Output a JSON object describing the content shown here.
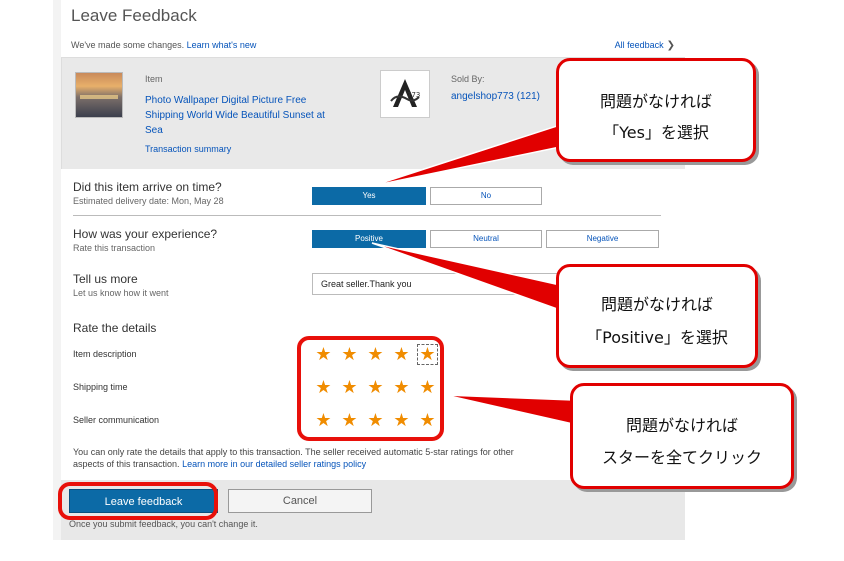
{
  "page": {
    "title": "Leave Feedback",
    "notice_text": "We've made some changes. ",
    "notice_link": "Learn what's new",
    "all_feedback": "All feedback"
  },
  "item": {
    "label": "Item",
    "title": "Photo Wallpaper Digital Picture Free Shipping World Wide Beautiful Sunset at Sea",
    "transaction_summary": "Transaction summary",
    "sold_by_label": "Sold By:",
    "seller": "angelshop773 (121)",
    "logo_text": "773"
  },
  "questions": {
    "arrive": {
      "title": "Did this item arrive on time?",
      "sub": "Estimated delivery date: Mon, May 28",
      "yes": "Yes",
      "no": "No",
      "selected": "Yes"
    },
    "experience": {
      "title": "How was your experience?",
      "sub": "Rate this transaction",
      "positive": "Positive",
      "neutral": "Neutral",
      "negative": "Negative",
      "selected": "Positive"
    },
    "more": {
      "title": "Tell us more",
      "sub": "Let us know how it went",
      "value": "Great seller.Thank you"
    }
  },
  "details": {
    "title": "Rate the details",
    "rows": [
      {
        "label": "Item description",
        "rating": 5
      },
      {
        "label": "Shipping time",
        "rating": 5
      },
      {
        "label": "Seller communication",
        "rating": 5
      }
    ],
    "footnote": "You can only rate the details that apply to this transaction. The seller received automatic 5-star ratings for other aspects of this transaction. ",
    "footnote_link": "Learn more in our detailed seller ratings policy"
  },
  "actions": {
    "leave": "Leave feedback",
    "cancel": "Cancel",
    "warning": "Once you submit feedback, you can't change it."
  },
  "callouts": {
    "yes": {
      "line1": "問題がなければ",
      "line2": "「Yes」を選択"
    },
    "positive": {
      "line1": "問題がなければ",
      "line2": "「Positive」を選択"
    },
    "stars": {
      "line1": "問題がなければ",
      "line2": "スターを全てクリック"
    }
  },
  "colors": {
    "accent": "#0c6aa6",
    "link": "#0654ba",
    "highlight": "#e8100a",
    "star": "#f08c00"
  }
}
